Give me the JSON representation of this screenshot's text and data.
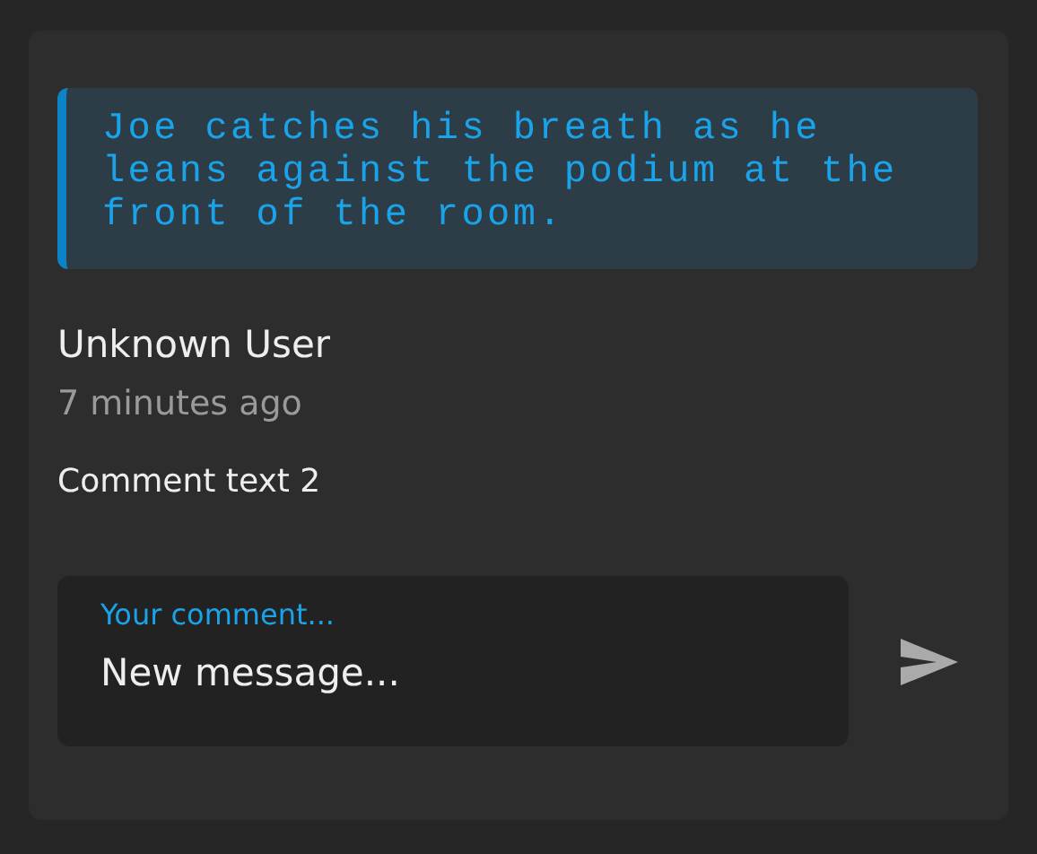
{
  "quote": {
    "text": "Joe catches his breath as he leans against the podium at the front of the room."
  },
  "comment": {
    "author": "Unknown User",
    "time": "7 minutes ago",
    "text": "Comment text 2"
  },
  "composer": {
    "label": "Your comment...",
    "value": "New message..."
  }
}
